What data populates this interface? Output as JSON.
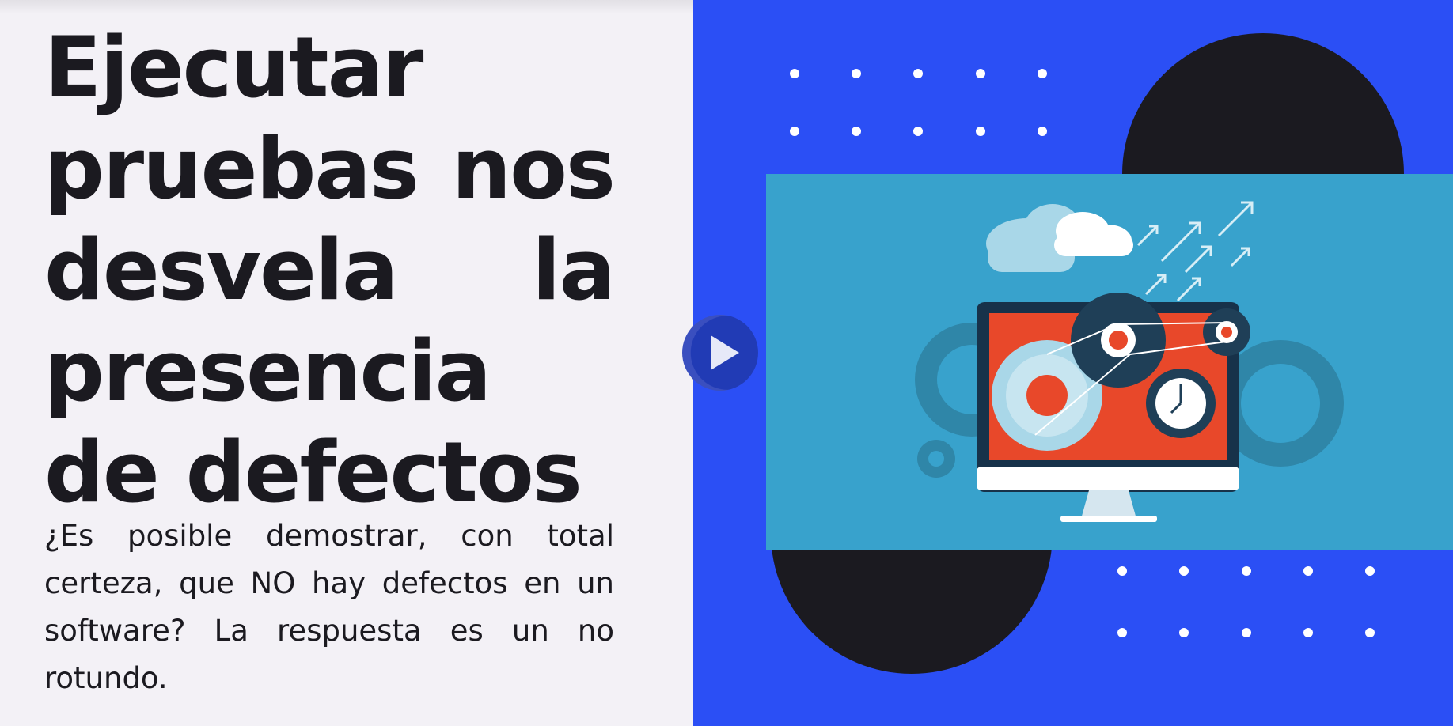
{
  "article": {
    "title": "Ejecutar pruebas nos desvela la presencia de defectos",
    "lead": "¿Es posible demostrar, con total certeza, que NO hay defectos en un software? La respuesta es un no rotundo."
  },
  "hero": {
    "illustration_icons": [
      "cloud-icon",
      "arrows-up-right-icon",
      "monitor-icon",
      "gear-icon",
      "clock-icon"
    ],
    "play_button_icon": "play-icon"
  },
  "colors": {
    "left_background": "#f3f1f6",
    "text": "#1b1a20",
    "hero_background": "#2b4ff5",
    "dark_circle": "#1b1a20",
    "illustration_background": "#38a2cc",
    "screen_orange": "#e8482a",
    "play_button": "#213bb5"
  }
}
